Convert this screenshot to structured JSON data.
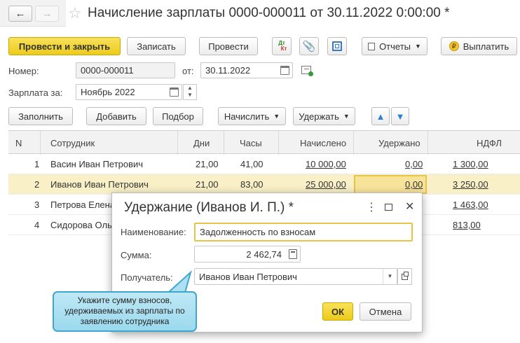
{
  "nav": {
    "back_icon": "arrow-left-icon",
    "forward_icon": "arrow-right-icon",
    "star_icon": "star-icon"
  },
  "title": "Начисление зарплаты 0000-000011 от 30.11.2022 0:00:00 *",
  "toolbar": {
    "post_close": "Провести и закрыть",
    "save": "Записать",
    "post": "Провести",
    "dt_kt_top": "Дт",
    "dt_kt_bottom": "Кт",
    "reports": "Отчеты",
    "pay": "Выплатить"
  },
  "form": {
    "number_label": "Номер:",
    "number_value": "0000-000011",
    "date_label": "от:",
    "date_value": "30.11.2022",
    "salary_label": "Зарплата за:",
    "salary_value": "Ноябрь 2022"
  },
  "actions": {
    "fill": "Заполнить",
    "add": "Добавить",
    "select": "Подбор",
    "accrue": "Начислить",
    "withhold": "Удержать"
  },
  "table": {
    "headers": [
      "N",
      "Сотрудник",
      "Дни",
      "Часы",
      "Начислено",
      "Удержано",
      "НДФЛ"
    ],
    "rows": [
      {
        "n": "1",
        "employee": "Васин Иван Петрович",
        "days": "21,00",
        "hours": "41,00",
        "accrued": "10 000,00",
        "withheld": "0,00",
        "ndfl": "1 300,00"
      },
      {
        "n": "2",
        "employee": "Иванов Иван Петрович",
        "days": "21,00",
        "hours": "83,00",
        "accrued": "25 000,00",
        "withheld": "0,00",
        "ndfl": "3 250,00"
      },
      {
        "n": "3",
        "employee": "Петрова Елена",
        "days": "",
        "hours": "",
        "accrued": "",
        "withheld": "",
        "ndfl": "1 463,00"
      },
      {
        "n": "4",
        "employee": "Сидорова Ольга",
        "days": "",
        "hours": "",
        "accrued": "",
        "withheld": "",
        "ndfl": "813,00"
      }
    ]
  },
  "dialog": {
    "title": "Удержание (Иванов И. П.) *",
    "name_label": "Наименование:",
    "name_value": "Задолженность по взносам",
    "sum_label": "Сумма:",
    "sum_value": "2 462,74",
    "recipient_label": "Получатель:",
    "recipient_value": "Иванов Иван Петрович",
    "ok": "ОК",
    "cancel": "Отмена"
  },
  "callout": {
    "line1": "Укажите сумму взносов,",
    "line2": "удерживаемых из зарплаты по",
    "line3": "заявлению сотрудника"
  },
  "colors": {
    "accent_yellow": "#f2d23a",
    "link_blue": "#1f4fb5",
    "selected_row": "#faf0c8",
    "callout_bg": "#aee0f2",
    "callout_border": "#3fa7cf"
  }
}
